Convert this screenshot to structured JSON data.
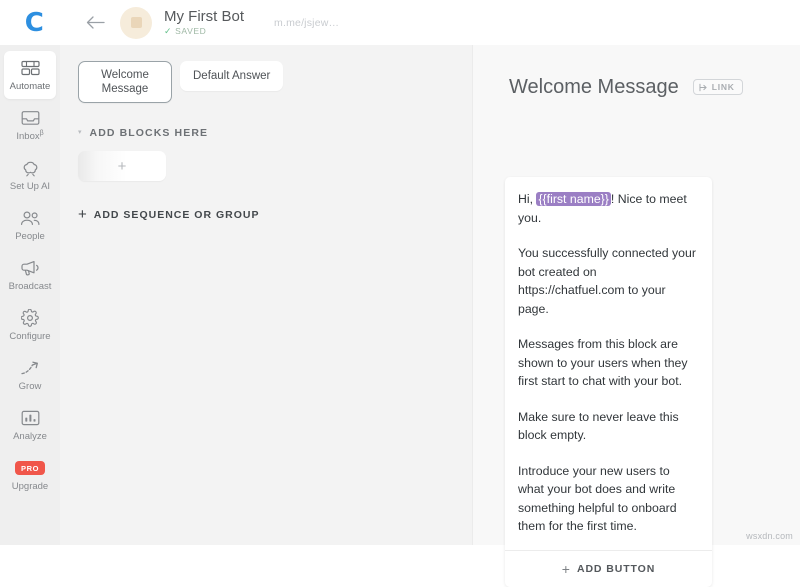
{
  "topbar": {
    "logo_text": "C",
    "back_icon": "arrow-left-icon",
    "bot_name": "My First Bot",
    "saved_label": "SAVED",
    "saved_check": "✓",
    "bot_url": "m.me/jsjew…"
  },
  "sidebar": {
    "items": [
      {
        "label": "Automate",
        "icon": "automate-blocks-icon",
        "active": true,
        "badge": ""
      },
      {
        "label": "Inbox",
        "icon": "inbox-tray-icon",
        "active": false,
        "badge": "β"
      },
      {
        "label": "Set Up AI",
        "icon": "ai-brain-icon",
        "active": false,
        "badge": ""
      },
      {
        "label": "People",
        "icon": "people-icon",
        "active": false,
        "badge": ""
      },
      {
        "label": "Broadcast",
        "icon": "megaphone-icon",
        "active": false,
        "badge": ""
      },
      {
        "label": "Configure",
        "icon": "gear-icon",
        "active": false,
        "badge": ""
      },
      {
        "label": "Grow",
        "icon": "trend-arrow-icon",
        "active": false,
        "badge": ""
      },
      {
        "label": "Analyze",
        "icon": "bar-chart-icon",
        "active": false,
        "badge": ""
      },
      {
        "label": "Upgrade",
        "icon": "pro-badge",
        "active": false,
        "badge": "PRO"
      }
    ],
    "pro_badge_color": "#f0564a"
  },
  "center": {
    "tabs": [
      {
        "label": "Welcome Message",
        "active": true
      },
      {
        "label": "Default Answer",
        "active": false
      }
    ],
    "section_caret": "▾",
    "section_title": "ADD BLOCKS HERE",
    "add_block_plus": "+",
    "add_sequence_plus": "+",
    "add_sequence_label": "ADD SEQUENCE OR GROUP"
  },
  "detail": {
    "title": "Welcome Message",
    "link_chip_label": "LINK",
    "link_chip_icon": "link-arrow-icon",
    "message": {
      "paragraphs": [
        {
          "before": "Hi, ",
          "token": "{{first name}}",
          "after": "! Nice to meet you."
        },
        {
          "text": "You successfully connected your bot created on https://chatfuel.com to your page."
        },
        {
          "text": "Messages from this block are shown to your users when they first start to chat with your bot."
        },
        {
          "text": "Make sure to never leave this block empty."
        },
        {
          "text": "Introduce your new users to what your bot does and write something helpful to onboard them for the first time."
        }
      ],
      "token_color": "#9b7fc4"
    },
    "add_button_plus": "+",
    "add_button_label": "ADD BUTTON"
  },
  "watermark": "wsxdn.com"
}
